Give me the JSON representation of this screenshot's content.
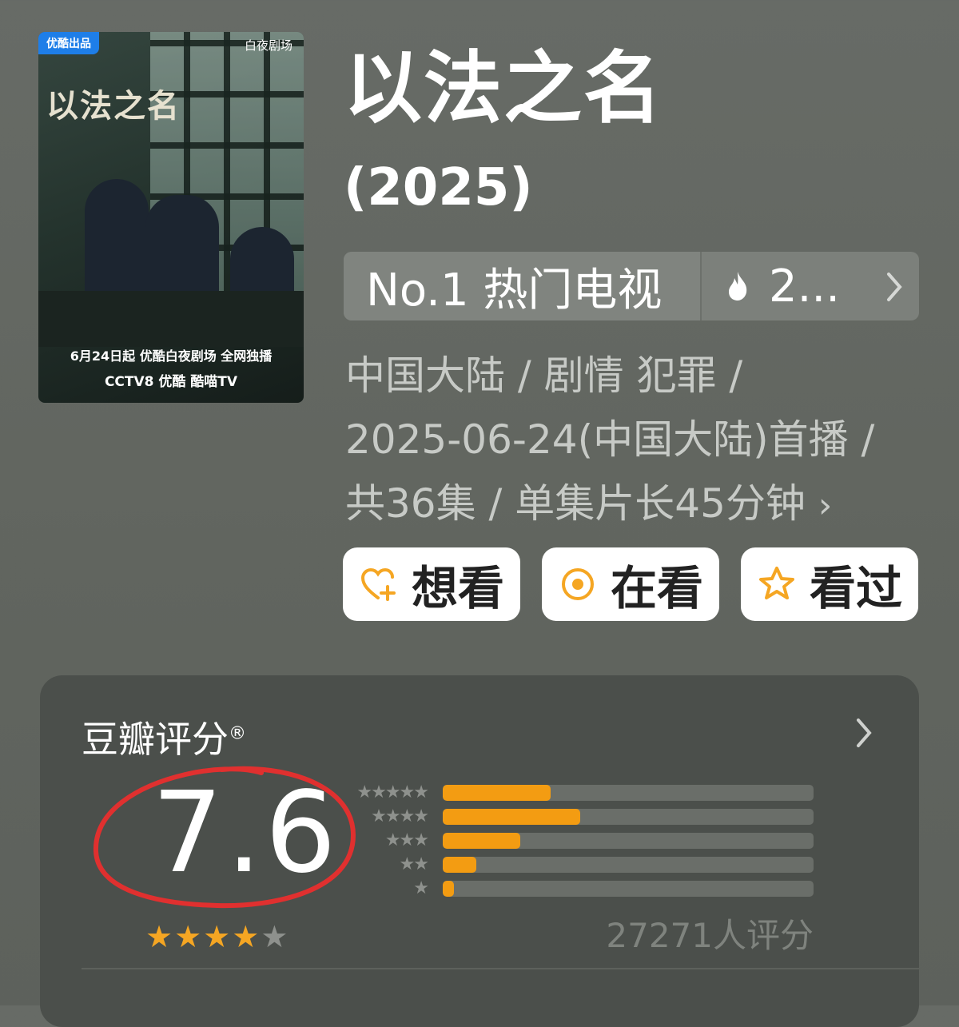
{
  "poster": {
    "badge": "优酷出品",
    "brand": "白夜剧场",
    "title": "以法之名",
    "release_line": "6月24日起 优酷白夜剧场 全网独播",
    "platforms": "CCTV8  优酷  酷喵TV"
  },
  "show": {
    "title": "以法之名",
    "year": "(2025)"
  },
  "rank": {
    "label": "No.1 热门电视",
    "hot_value": "2...",
    "flame_icon": "flame-icon",
    "chevron_icon": "chevron-right-icon"
  },
  "meta": {
    "line1": "中国大陆 / 剧情 犯罪 /",
    "line2": "2025-06-24(中国大陆)首播 /",
    "line3": "共36集 / 单集片长45分钟",
    "chevron": "›"
  },
  "actions": [
    {
      "label": "想看",
      "icon": "heart-plus-icon"
    },
    {
      "label": "在看",
      "icon": "target-circle-icon"
    },
    {
      "label": "看过",
      "icon": "star-outline-icon"
    }
  ],
  "rating": {
    "title": "豆瓣评分",
    "registered": "®",
    "score": "7.6",
    "stars": 4,
    "stars_total": 5,
    "count_text": "27271人评分",
    "distribution": [
      {
        "stars": "★★★★★",
        "fraction": 0.29
      },
      {
        "stars": "★★★★",
        "fraction": 0.37
      },
      {
        "stars": "★★★",
        "fraction": 0.21
      },
      {
        "stars": "★★",
        "fraction": 0.09
      },
      {
        "stars": "★",
        "fraction": 0.03
      }
    ],
    "colors": {
      "accent": "#f39c12",
      "circle": "#e0302f"
    }
  }
}
